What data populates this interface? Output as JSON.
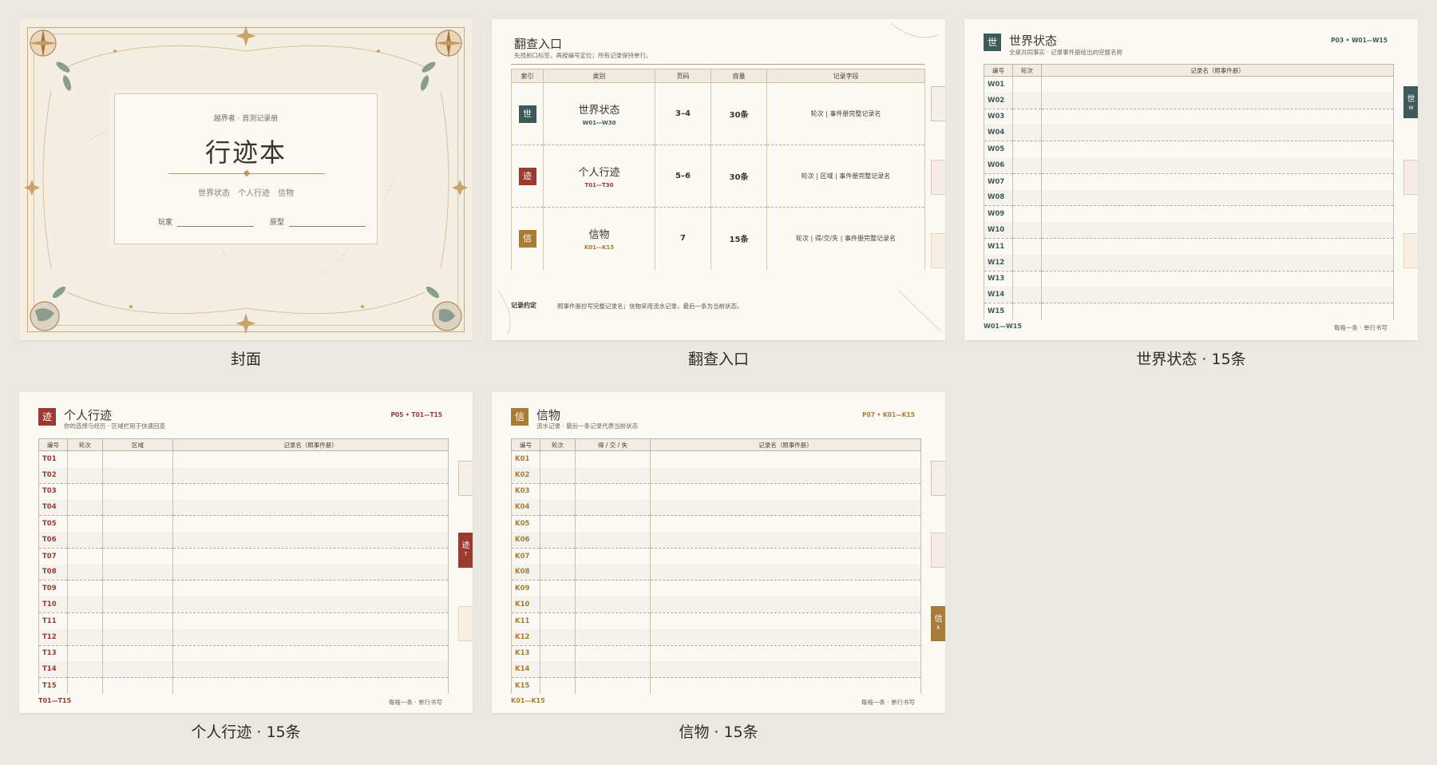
{
  "colors": {
    "world": "#3e5b5a",
    "trail": "#9a3a30",
    "token": "#a97b34",
    "background": "#ebe8e2"
  },
  "cover": {
    "caption": "封面",
    "eyebrow": "越界者 · 首测记录册",
    "title": "行迹本",
    "subtitle": "世界状态　个人行迹　信物",
    "player_label": "玩家",
    "archetype_label": "原型"
  },
  "index": {
    "caption": "翻查入口",
    "title": "翻查入口",
    "subtitle": "先找前口标签，再按编号定位；所有记录保持单行。",
    "headers": [
      "索引",
      "类别",
      "页码",
      "容量",
      "记录字段"
    ],
    "rows": [
      {
        "badge": "世",
        "name": "世界状态",
        "range": "W01—W30",
        "pages": "3–4",
        "capacity": "30条",
        "fields": "轮次 | 事件册完整记录名",
        "color": "#3e5b5a"
      },
      {
        "badge": "迹",
        "name": "个人行迹",
        "range": "T01—T30",
        "pages": "5–6",
        "capacity": "30条",
        "fields": "轮次 | 区域 | 事件册完整记录名",
        "color": "#9a3a30"
      },
      {
        "badge": "信",
        "name": "信物",
        "range": "K01—K15",
        "pages": "7",
        "capacity": "15条",
        "fields": "轮次 | 得/交/失 | 事件册完整记录名",
        "color": "#a97b34"
      }
    ],
    "rule_label": "记录约定",
    "rule_text": "照事件册抄写完整记录名；信物采用流水记录，最后一条为当前状态。"
  },
  "world": {
    "caption": "世界状态 · 15条",
    "badge": "世",
    "title": "世界状态",
    "subtitle": "全桌共同事实 · 记录事件册给出的完整名称",
    "code": "P03 • W01—W15",
    "headers": [
      "编号",
      "轮次",
      "记录名（照事件册）"
    ],
    "rows": [
      "W01",
      "W02",
      "W03",
      "W04",
      "W05",
      "W06",
      "W07",
      "W08",
      "W09",
      "W10",
      "W11",
      "W12",
      "W13",
      "W14",
      "W15"
    ],
    "footer_left": "W01—W15",
    "footer_right": "每格一条 · 单行书写",
    "tab_label": "世",
    "tab_sub": "W"
  },
  "trail": {
    "caption": "个人行迹 · 15条",
    "badge": "迹",
    "title": "个人行迹",
    "subtitle": "你的选择与经历 · 区域栏用于快速回查",
    "code": "P05 • T01—T15",
    "headers": [
      "编号",
      "轮次",
      "区域",
      "记录名（照事件册）"
    ],
    "rows": [
      "T01",
      "T02",
      "T03",
      "T04",
      "T05",
      "T06",
      "T07",
      "T08",
      "T09",
      "T10",
      "T11",
      "T12",
      "T13",
      "T14",
      "T15"
    ],
    "footer_left": "T01—T15",
    "footer_right": "每格一条 · 单行书写",
    "tab_label": "迹",
    "tab_sub": "T"
  },
  "token": {
    "caption": "信物 · 15条",
    "badge": "信",
    "title": "信物",
    "subtitle": "流水记录 · 最后一条记录代表当前状态",
    "code": "P07 • K01—K15",
    "headers": [
      "编号",
      "轮次",
      "得 / 交 / 失",
      "记录名（照事件册）"
    ],
    "rows": [
      "K01",
      "K02",
      "K03",
      "K04",
      "K05",
      "K06",
      "K07",
      "K08",
      "K09",
      "K10",
      "K11",
      "K12",
      "K13",
      "K14",
      "K15"
    ],
    "footer_left": "K01—K15",
    "footer_right": "每格一条 · 单行书写",
    "tab_label": "信",
    "tab_sub": "K"
  }
}
